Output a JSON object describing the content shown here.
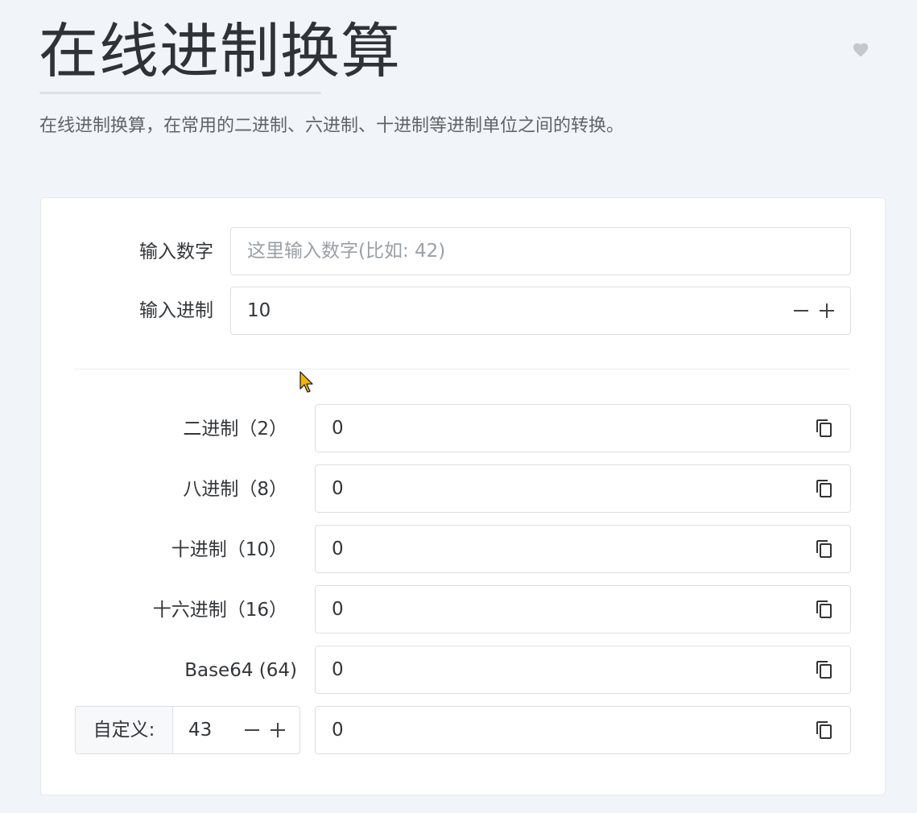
{
  "header": {
    "title": "在线进制换算",
    "subtitle": "在线进制换算，在常用的二进制、六进制、十进制等进制单位之间的转换。",
    "favorite_icon": "heart-icon"
  },
  "input": {
    "number_label": "输入数字",
    "number_placeholder": "这里输入数字(比如: 42)",
    "number_value": "",
    "base_label": "输入进制",
    "base_value": "10"
  },
  "outputs": [
    {
      "label": "二进制（2）",
      "value": "0"
    },
    {
      "label": "八进制（8）",
      "value": "0"
    },
    {
      "label": "十进制（10）",
      "value": "0"
    },
    {
      "label": "十六进制（16）",
      "value": "0"
    },
    {
      "label": "Base64 (64)",
      "value": "0"
    }
  ],
  "custom": {
    "prefix": "自定义:",
    "base_value": "43",
    "value": "0"
  },
  "icons": {
    "minus": "minus-icon",
    "plus": "plus-icon",
    "copy": "copy-icon"
  }
}
